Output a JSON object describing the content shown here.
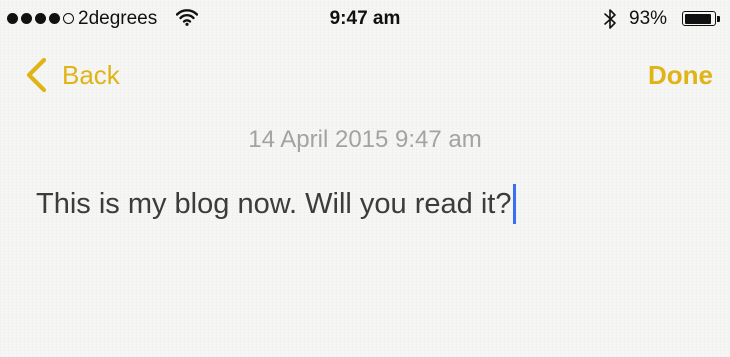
{
  "status_bar": {
    "carrier": "2degrees",
    "time": "9:47 am",
    "battery_percent": "93%",
    "battery_level": 0.93,
    "signal_bars_filled": 4,
    "signal_bars_total": 5
  },
  "nav": {
    "back_label": "Back",
    "done_label": "Done"
  },
  "note": {
    "date": "14 April 2015 9:47 am",
    "body": "This is my blog now. Will you read it?"
  },
  "colors": {
    "accent": "#e0b317",
    "cursor": "#3d6ff3",
    "date_text": "#a3a3a3",
    "body_text": "#3c3c3c"
  }
}
